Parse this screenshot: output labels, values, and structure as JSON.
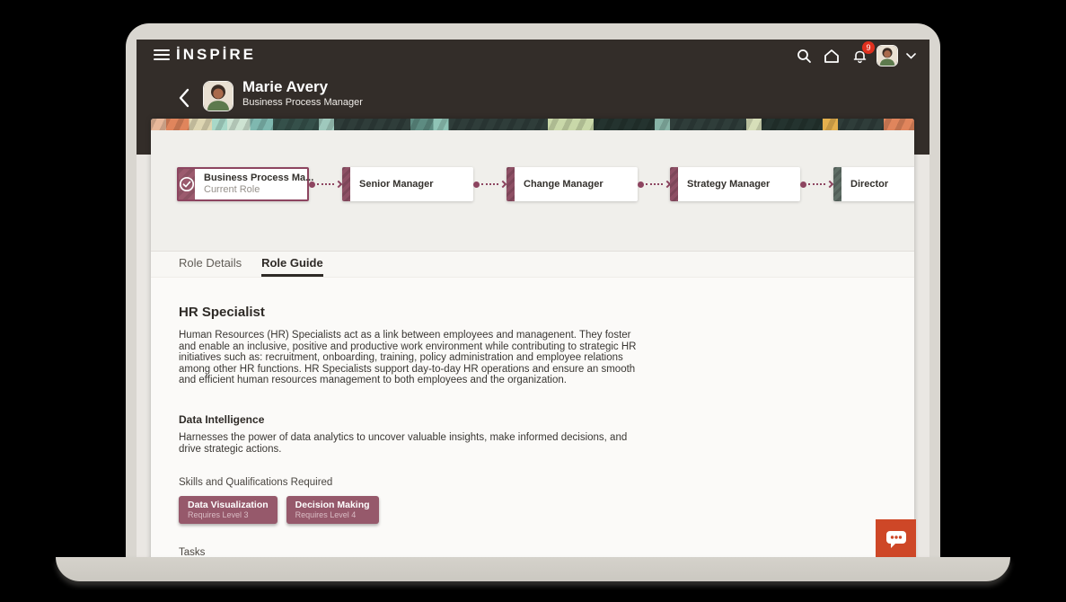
{
  "app": {
    "logo": "İNSPİRE",
    "nav": {
      "notification_count": "9"
    }
  },
  "profile": {
    "name": "Marie Avery",
    "title": "Business Process Manager"
  },
  "career_path": [
    {
      "label": "Business Process Ma...",
      "sublabel": "Current Role",
      "current": true
    },
    {
      "label": "Senior Manager"
    },
    {
      "label": "Change Manager"
    },
    {
      "label": "Strategy Manager"
    },
    {
      "label": "Director"
    }
  ],
  "tabs": [
    {
      "label": "Role Details",
      "active": false
    },
    {
      "label": "Role Guide",
      "active": true
    }
  ],
  "role_guide": {
    "heading": "HR Specialist",
    "description": "Human Resources (HR) Specialists act as a link between employees and managenent. They foster and enable an inclusive, positive and productive work environment while contributing to strategic HR initiatives such as: recruitment, onboarding, training, policy administration and employee relations among other HR functions. HR Specialists support day-to-day HR operations and ensure an smooth and efficient human resources management to both employees and the organization.",
    "focus_heading": "Data Intelligence",
    "focus_description": "Harnesses the power of data analytics to uncover valuable insights, make informed decisions, and drive strategic actions.",
    "skills_label": "Skills and Qualifications Required",
    "skills": [
      {
        "name": "Data Visualization",
        "level": "Requires Level 3"
      },
      {
        "name": "Decision Making",
        "level": "Requires Level 4"
      }
    ],
    "tasks_label": "Tasks"
  },
  "colors": {
    "accent_maroon": "#8d4560",
    "accent_teal": "#5f6e66",
    "header_dark": "#332d29",
    "chat_orange": "#ce4727",
    "badge_red": "#e0301e"
  }
}
